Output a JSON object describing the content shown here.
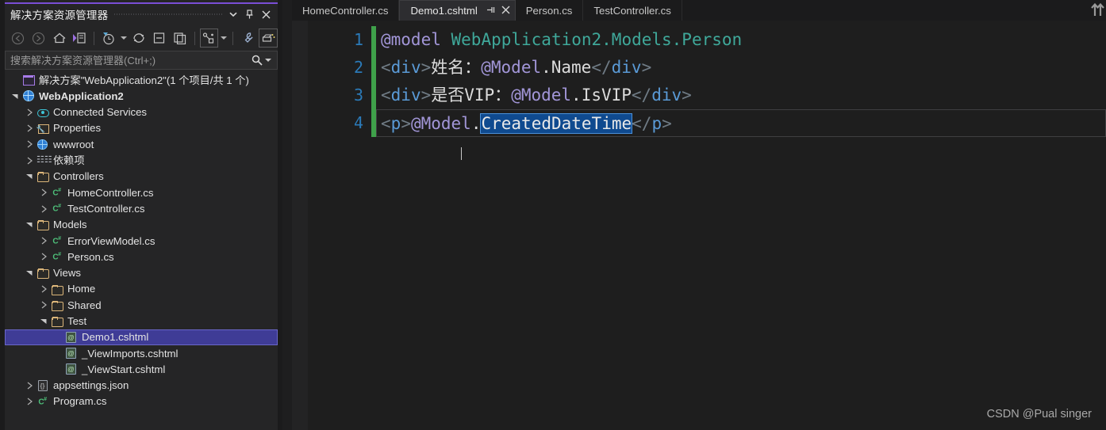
{
  "solution_explorer": {
    "title": "解决方案资源管理器",
    "title_buttons": [
      {
        "name": "dropdown-icon",
        "glyph": "▾"
      },
      {
        "name": "pin-icon",
        "glyph": "📌"
      },
      {
        "name": "close-icon",
        "glyph": "✕"
      }
    ],
    "toolbar": [
      {
        "name": "back-button",
        "label": "Back"
      },
      {
        "name": "forward-button",
        "label": "Forward"
      },
      {
        "name": "home-button",
        "label": "Home"
      },
      {
        "name": "sync-with-active-document-button",
        "label": "Sync with Active Document"
      },
      {
        "name": "pending-changes-filter-button",
        "label": "Pending Changes Filter"
      },
      {
        "name": "refresh-button",
        "label": "Refresh"
      },
      {
        "name": "collapse-all-button",
        "label": "Collapse All"
      },
      {
        "name": "show-all-files-button",
        "label": "Show All Files"
      },
      {
        "name": "view-code-map-button",
        "label": "View Code Map"
      },
      {
        "name": "properties-button",
        "label": "Properties"
      },
      {
        "name": "preview-selected-items-button",
        "label": "Preview Selected Items"
      }
    ],
    "search": {
      "placeholder": "搜索解决方案资源管理器(Ctrl+;)",
      "value": ""
    },
    "tree": [
      {
        "indent": 0,
        "expander": "none",
        "icon": "solution-icon",
        "label": "解决方案\"WebApplication2\"(1 个项目/共 1 个)",
        "bold": false,
        "selected": false
      },
      {
        "indent": 0,
        "expander": "expanded",
        "icon": "project-icon",
        "label": "WebApplication2",
        "bold": true,
        "selected": false
      },
      {
        "indent": 1,
        "expander": "collapsed",
        "icon": "cloud-icon",
        "label": "Connected Services",
        "bold": false,
        "selected": false
      },
      {
        "indent": 1,
        "expander": "collapsed",
        "icon": "properties-icon",
        "label": "Properties",
        "bold": false,
        "selected": false
      },
      {
        "indent": 1,
        "expander": "collapsed",
        "icon": "globe-icon",
        "label": "wwwroot",
        "bold": false,
        "selected": false
      },
      {
        "indent": 1,
        "expander": "collapsed",
        "icon": "dependencies-icon",
        "label": "依赖项",
        "bold": false,
        "selected": false
      },
      {
        "indent": 1,
        "expander": "expanded",
        "icon": "folder-icon",
        "label": "Controllers",
        "bold": false,
        "selected": false
      },
      {
        "indent": 2,
        "expander": "collapsed",
        "icon": "csharp-icon",
        "label": "HomeController.cs",
        "bold": false,
        "selected": false
      },
      {
        "indent": 2,
        "expander": "collapsed",
        "icon": "csharp-icon",
        "label": "TestController.cs",
        "bold": false,
        "selected": false
      },
      {
        "indent": 1,
        "expander": "expanded",
        "icon": "folder-icon",
        "label": "Models",
        "bold": false,
        "selected": false
      },
      {
        "indent": 2,
        "expander": "collapsed",
        "icon": "csharp-icon",
        "label": "ErrorViewModel.cs",
        "bold": false,
        "selected": false
      },
      {
        "indent": 2,
        "expander": "collapsed",
        "icon": "csharp-icon",
        "label": "Person.cs",
        "bold": false,
        "selected": false
      },
      {
        "indent": 1,
        "expander": "expanded",
        "icon": "folder-icon",
        "label": "Views",
        "bold": false,
        "selected": false
      },
      {
        "indent": 2,
        "expander": "collapsed",
        "icon": "folder-icon",
        "label": "Home",
        "bold": false,
        "selected": false
      },
      {
        "indent": 2,
        "expander": "collapsed",
        "icon": "folder-icon",
        "label": "Shared",
        "bold": false,
        "selected": false
      },
      {
        "indent": 2,
        "expander": "expanded",
        "icon": "folder-icon",
        "label": "Test",
        "bold": false,
        "selected": false
      },
      {
        "indent": 3,
        "expander": "none",
        "icon": "cshtml-icon",
        "label": "Demo1.cshtml",
        "bold": false,
        "selected": true
      },
      {
        "indent": 3,
        "expander": "none",
        "icon": "cshtml-icon",
        "label": "_ViewImports.cshtml",
        "bold": false,
        "selected": false
      },
      {
        "indent": 3,
        "expander": "none",
        "icon": "cshtml-icon",
        "label": "_ViewStart.cshtml",
        "bold": false,
        "selected": false
      },
      {
        "indent": 1,
        "expander": "collapsed",
        "icon": "json-icon",
        "label": "appsettings.json",
        "bold": false,
        "selected": false
      },
      {
        "indent": 1,
        "expander": "collapsed",
        "icon": "csharp-icon",
        "label": "Program.cs",
        "bold": false,
        "selected": false
      }
    ]
  },
  "editor": {
    "tabs": [
      {
        "label": "HomeController.cs",
        "active": false,
        "has_actions": false
      },
      {
        "label": "Demo1.cshtml",
        "active": true,
        "has_actions": true,
        "pin_glyph": "⚐",
        "close_glyph": "✕"
      },
      {
        "label": "Person.cs",
        "active": false,
        "has_actions": false
      },
      {
        "label": "TestController.cs",
        "active": false,
        "has_actions": false
      }
    ],
    "line_numbers": [
      "1",
      "2",
      "3",
      "4"
    ],
    "code_lines": [
      {
        "current": false,
        "tokens": [
          {
            "text": "@model",
            "cls": "tk-razor"
          },
          {
            "text": " ",
            "cls": "tk-plain"
          },
          {
            "text": "WebApplication2.Models.Person",
            "cls": "tk-type"
          }
        ]
      },
      {
        "current": false,
        "tokens": [
          {
            "text": "<",
            "cls": "tk-punct"
          },
          {
            "text": "div",
            "cls": "tk-tag"
          },
          {
            "text": ">",
            "cls": "tk-punct"
          },
          {
            "text": "姓名：",
            "cls": "tk-plain"
          },
          {
            "text": "@Model",
            "cls": "tk-razor"
          },
          {
            "text": ".Name",
            "cls": "tk-plain"
          },
          {
            "text": "</",
            "cls": "tk-punct"
          },
          {
            "text": "div",
            "cls": "tk-tag"
          },
          {
            "text": ">",
            "cls": "tk-punct"
          }
        ]
      },
      {
        "current": false,
        "tokens": [
          {
            "text": "<",
            "cls": "tk-punct"
          },
          {
            "text": "div",
            "cls": "tk-tag"
          },
          {
            "text": ">",
            "cls": "tk-punct"
          },
          {
            "text": "是否VIP：",
            "cls": "tk-plain"
          },
          {
            "text": "@Model",
            "cls": "tk-razor"
          },
          {
            "text": ".IsVIP",
            "cls": "tk-plain"
          },
          {
            "text": "</",
            "cls": "tk-punct"
          },
          {
            "text": "div",
            "cls": "tk-tag"
          },
          {
            "text": ">",
            "cls": "tk-punct"
          }
        ]
      },
      {
        "current": true,
        "tokens": [
          {
            "text": "<",
            "cls": "tk-punct"
          },
          {
            "text": "p",
            "cls": "tk-tag"
          },
          {
            "text": ">",
            "cls": "tk-punct"
          },
          {
            "text": "@Model",
            "cls": "tk-razor"
          },
          {
            "text": ".",
            "cls": "tk-plain"
          },
          {
            "text": "CreatedDateTime",
            "cls": "tk-sel"
          },
          {
            "text": "</",
            "cls": "tk-punct"
          },
          {
            "text": "p",
            "cls": "tk-tag"
          },
          {
            "text": ">",
            "cls": "tk-punct"
          }
        ]
      }
    ]
  },
  "watermark": "CSDN @Pual singer",
  "colors": {
    "panel_bg": "#252526",
    "editor_bg": "#1e1e1e",
    "accent_purple": "#7a4ed6",
    "selection_blue": "#3f3c96",
    "text_selection": "#0f4a8f",
    "change_bar_green": "#3fa14a",
    "line_number": "#2b7ab8",
    "razor_purple": "#a296d8",
    "type_teal": "#3fa89a",
    "tag_blue": "#5a9ad6"
  }
}
